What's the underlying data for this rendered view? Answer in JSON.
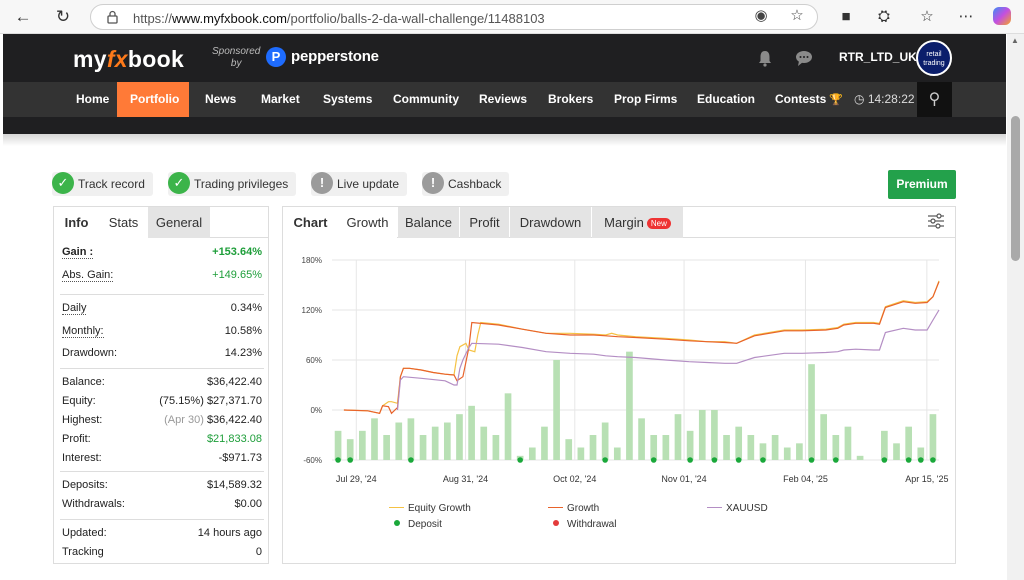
{
  "browser": {
    "url_prefix": "https://",
    "url_domain": "www.myfxbook.com",
    "url_path": "/portfolio/balls-2-da-wall-challenge/11488103"
  },
  "header": {
    "logo_my": "my",
    "logo_fx": "fx",
    "logo_book": "book",
    "sponsored_line1": "Sponsored",
    "sponsored_line2": "by",
    "sponsor_name": "pepperstone",
    "username": "RTR_LTD_UK",
    "avatar_text": "retail trading",
    "clock": "14:28:22"
  },
  "nav": {
    "items": [
      "Home",
      "Portfolio",
      "News",
      "Market",
      "Systems",
      "Community",
      "Reviews",
      "Brokers",
      "Prop Firms",
      "Education",
      "Contests"
    ],
    "active": "Portfolio"
  },
  "badges": {
    "track_record": "Track record",
    "trading_privileges": "Trading privileges",
    "live_update": "Live update",
    "cashback": "Cashback"
  },
  "premium_label": "Premium",
  "info_panel": {
    "tabs": [
      "Info",
      "Stats",
      "General"
    ],
    "rows": {
      "gain": {
        "label": "Gain :",
        "value": "+153.64%"
      },
      "abs_gain": {
        "label": "Abs. Gain:",
        "value": "+149.65%"
      },
      "daily": {
        "label": "Daily",
        "value": "0.34%"
      },
      "monthly": {
        "label": "Monthly:",
        "value": "10.58%"
      },
      "drawdown": {
        "label": "Drawdown:",
        "value": "14.23%"
      },
      "balance": {
        "label": "Balance:",
        "value": "$36,422.40"
      },
      "equity": {
        "label": "Equity:",
        "note": "(75.15%)",
        "value": "$27,371.70"
      },
      "highest": {
        "label": "Highest:",
        "note": "(Apr 30)",
        "value": "$36,422.40"
      },
      "profit": {
        "label": "Profit:",
        "value": "$21,833.08"
      },
      "interest": {
        "label": "Interest:",
        "value": "-$971.73"
      },
      "deposits": {
        "label": "Deposits:",
        "value": "$14,589.32"
      },
      "withdrawals": {
        "label": "Withdrawals:",
        "value": "$0.00"
      },
      "updated": {
        "label": "Updated:",
        "value": "14 hours ago"
      },
      "tracking": {
        "label": "Tracking",
        "value": "0"
      }
    }
  },
  "chart_panel": {
    "tabs": [
      "Chart",
      "Growth",
      "Balance",
      "Profit",
      "Drawdown",
      "Margin"
    ],
    "new_tag": "New"
  },
  "chart_data": {
    "type": "line",
    "ytick_labels": [
      "180%",
      "120%",
      "60%",
      "0%",
      "-60%"
    ],
    "yticks": [
      180,
      120,
      60,
      0,
      -60
    ],
    "ylim": [
      -60,
      180
    ],
    "xtick_labels": [
      "Jul 29, '24",
      "Aug 31, '24",
      "Oct 02, '24",
      "Nov 01, '24",
      "Feb 04, '25",
      "Apr 15, '25"
    ],
    "grid": true,
    "legend_placement": "bottom",
    "legend": [
      "Equity Growth",
      "Growth",
      "XAUUSD",
      "Deposit",
      "Withdrawal"
    ],
    "colors": {
      "equity": "#f5c244",
      "growth": "#e8632b",
      "xauusd": "#b48ec4",
      "bars": "#b8e0b4",
      "deposit": "#1aa83a",
      "withdrawal": "#e33b3b"
    },
    "n_points": 50,
    "series": [
      {
        "name": "Equity Growth",
        "points": [
          [
            2,
            0
          ],
          [
            6,
            -1
          ],
          [
            8,
            -4
          ],
          [
            8.5,
            5
          ],
          [
            9.5,
            10
          ],
          [
            10,
            10
          ],
          [
            11,
            8
          ],
          [
            11.5,
            40
          ],
          [
            12,
            50
          ],
          [
            13,
            50
          ],
          [
            15,
            48
          ],
          [
            17,
            45
          ],
          [
            19,
            43
          ],
          [
            20.5,
            42
          ],
          [
            21,
            65
          ],
          [
            21.5,
            76
          ],
          [
            22.5,
            80
          ],
          [
            23,
            72
          ],
          [
            24,
            70
          ],
          [
            24.5,
            90
          ],
          [
            25,
            105
          ],
          [
            28,
            103
          ],
          [
            32,
            97
          ],
          [
            36,
            92
          ],
          [
            40,
            92
          ],
          [
            44,
            91
          ],
          [
            46,
            90
          ],
          [
            47,
            92
          ],
          [
            48,
            90
          ],
          [
            51,
            88
          ],
          [
            56,
            86
          ],
          [
            60,
            84
          ],
          [
            63,
            82
          ],
          [
            66,
            82
          ],
          [
            68,
            80
          ],
          [
            71,
            90
          ],
          [
            76,
            96
          ],
          [
            79,
            96
          ],
          [
            83,
            97
          ],
          [
            85,
            99
          ],
          [
            86,
            103
          ],
          [
            88,
            105
          ],
          [
            91,
            105
          ],
          [
            92,
            104
          ],
          [
            93,
            124
          ],
          [
            96,
            131
          ],
          [
            98,
            129
          ],
          [
            100,
            130
          ],
          [
            101,
            136
          ],
          [
            102,
            155
          ]
        ]
      },
      {
        "name": "Growth",
        "points": [
          [
            2,
            0
          ],
          [
            6,
            -1
          ],
          [
            8,
            -4
          ],
          [
            8.5,
            5
          ],
          [
            9.5,
            4
          ],
          [
            10,
            -4
          ],
          [
            11,
            3
          ],
          [
            11.5,
            40
          ],
          [
            12,
            50
          ],
          [
            13,
            50
          ],
          [
            15,
            48
          ],
          [
            17,
            45
          ],
          [
            19,
            43
          ],
          [
            20.5,
            42
          ],
          [
            21,
            35
          ],
          [
            22,
            40
          ],
          [
            23,
            75
          ],
          [
            23.5,
            105
          ],
          [
            28,
            102
          ],
          [
            32,
            97
          ],
          [
            36,
            92
          ],
          [
            40,
            90
          ],
          [
            44,
            90
          ],
          [
            46,
            89
          ],
          [
            48,
            88
          ],
          [
            51,
            87
          ],
          [
            56,
            85
          ],
          [
            60,
            83
          ],
          [
            63,
            82
          ],
          [
            66,
            81
          ],
          [
            68,
            80
          ],
          [
            71,
            89
          ],
          [
            76,
            95
          ],
          [
            79,
            95
          ],
          [
            83,
            96
          ],
          [
            85,
            98
          ],
          [
            86,
            102
          ],
          [
            88,
            104
          ],
          [
            91,
            104
          ],
          [
            92,
            103
          ],
          [
            93,
            123
          ],
          [
            96,
            130
          ],
          [
            98,
            128
          ],
          [
            100,
            129
          ],
          [
            101,
            136
          ],
          [
            102,
            154
          ]
        ]
      },
      {
        "name": "XAUUSD",
        "points": [
          [
            11,
            0
          ],
          [
            11.5,
            36
          ],
          [
            12,
            40
          ],
          [
            15,
            38
          ],
          [
            19,
            35
          ],
          [
            20.5,
            30
          ],
          [
            21,
            30
          ],
          [
            21.5,
            50
          ],
          [
            22,
            60
          ],
          [
            23,
            75
          ],
          [
            23.5,
            80
          ],
          [
            28,
            79
          ],
          [
            32,
            75
          ],
          [
            36,
            70
          ],
          [
            40,
            68
          ],
          [
            44,
            67
          ],
          [
            46,
            65
          ],
          [
            48,
            64
          ],
          [
            51,
            63
          ],
          [
            56,
            60
          ],
          [
            60,
            58
          ],
          [
            63,
            57
          ],
          [
            66,
            56
          ],
          [
            68,
            56
          ],
          [
            71,
            63
          ],
          [
            76,
            68
          ],
          [
            79,
            68
          ],
          [
            83,
            69
          ],
          [
            85,
            70
          ],
          [
            86,
            72
          ],
          [
            88,
            73
          ],
          [
            91,
            72
          ],
          [
            92,
            72
          ],
          [
            93,
            93
          ],
          [
            96,
            98
          ],
          [
            98,
            96
          ],
          [
            100,
            96
          ],
          [
            101,
            108
          ],
          [
            102,
            120
          ]
        ]
      }
    ],
    "bars": [
      {
        "i": 0,
        "v": -25
      },
      {
        "i": 1,
        "v": -35
      },
      {
        "i": 2,
        "v": -25
      },
      {
        "i": 3,
        "v": -10
      },
      {
        "i": 4,
        "v": -30
      },
      {
        "i": 5,
        "v": -15
      },
      {
        "i": 6,
        "v": -10
      },
      {
        "i": 7,
        "v": -30
      },
      {
        "i": 8,
        "v": -20
      },
      {
        "i": 9,
        "v": -15
      },
      {
        "i": 10,
        "v": -5
      },
      {
        "i": 11,
        "v": 5
      },
      {
        "i": 12,
        "v": -20
      },
      {
        "i": 13,
        "v": -30
      },
      {
        "i": 14,
        "v": 20
      },
      {
        "i": 15,
        "v": -55
      },
      {
        "i": 16,
        "v": -45
      },
      {
        "i": 17,
        "v": -20
      },
      {
        "i": 18,
        "v": 60
      },
      {
        "i": 19,
        "v": -35
      },
      {
        "i": 20,
        "v": -45
      },
      {
        "i": 21,
        "v": -30
      },
      {
        "i": 22,
        "v": -15
      },
      {
        "i": 23,
        "v": -45
      },
      {
        "i": 24,
        "v": 70
      },
      {
        "i": 25,
        "v": -10
      },
      {
        "i": 26,
        "v": -30
      },
      {
        "i": 27,
        "v": -30
      },
      {
        "i": 28,
        "v": -5
      },
      {
        "i": 29,
        "v": -25
      },
      {
        "i": 30,
        "v": 0
      },
      {
        "i": 31,
        "v": 0
      },
      {
        "i": 32,
        "v": -30
      },
      {
        "i": 33,
        "v": -20
      },
      {
        "i": 34,
        "v": -30
      },
      {
        "i": 35,
        "v": -40
      },
      {
        "i": 36,
        "v": -30
      },
      {
        "i": 37,
        "v": -45
      },
      {
        "i": 38,
        "v": -40
      },
      {
        "i": 39,
        "v": 55
      },
      {
        "i": 40,
        "v": -5
      },
      {
        "i": 41,
        "v": -30
      },
      {
        "i": 42,
        "v": -20
      },
      {
        "i": 43,
        "v": -55
      },
      {
        "i": 44,
        "v": -60
      },
      {
        "i": 45,
        "v": -25
      },
      {
        "i": 46,
        "v": -40
      },
      {
        "i": 47,
        "v": -20
      },
      {
        "i": 48,
        "v": -45
      },
      {
        "i": 49,
        "v": -5
      }
    ],
    "deposit_positions": [
      0,
      1,
      6,
      15,
      22,
      26,
      29,
      31,
      33,
      35,
      39,
      41,
      45,
      47,
      48,
      49
    ],
    "withdrawal_positions": []
  }
}
